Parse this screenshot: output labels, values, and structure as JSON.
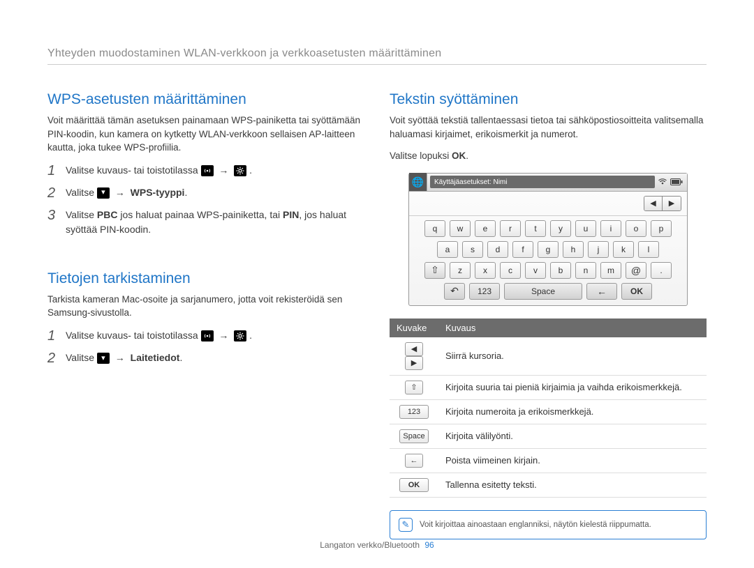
{
  "header": {
    "title": "Yhteyden muodostaminen WLAN-verkkoon ja verkkoasetusten määrittäminen"
  },
  "left": {
    "sec1": {
      "title": "WPS-asetusten määrittäminen",
      "intro": "Voit määrittää tämän asetuksen painamaan WPS-painiketta tai syöttämään PIN-koodin, kun kamera on kytketty WLAN-verkkoon sellaisen AP-laitteen kautta, joka tukee WPS-profiilia.",
      "step1_pre": "Valitse kuvaus- tai toistotilassa",
      "step2_pre": "Valitse",
      "step2_bold": "WPS-tyyppi",
      "step3_a": "Valitse ",
      "step3_pbc": "PBC",
      "step3_b": " jos haluat painaa WPS-painiketta, tai ",
      "step3_pin": "PIN",
      "step3_c": ", jos haluat syöttää PIN-koodin.",
      "dot": "."
    },
    "sec2": {
      "title": "Tietojen tarkistaminen",
      "intro": "Tarkista kameran Mac-osoite ja sarjanumero, jotta voit rekisteröidä sen Samsung-sivustolla.",
      "step1_pre": "Valitse kuvaus- tai toistotilassa",
      "step2_pre": "Valitse",
      "step2_bold": "Laitetiedot",
      "dot": "."
    }
  },
  "right": {
    "title": "Tekstin syöttäminen",
    "intro": "Voit syöttää tekstiä tallentaessasi tietoa tai sähköpostiosoitteita valitsemalla haluamasi kirjaimet, erikoismerkit ja numerot.",
    "closing_pre": "Valitse lopuksi ",
    "closing_ok": "OK",
    "closing_dot": "."
  },
  "keyboard": {
    "title": "Käyttäjäasetukset: Nimi",
    "row1": [
      "q",
      "w",
      "e",
      "r",
      "t",
      "y",
      "u",
      "i",
      "o",
      "p"
    ],
    "row2": [
      "a",
      "s",
      "d",
      "f",
      "g",
      "h",
      "j",
      "k",
      "l"
    ],
    "row3_mid": [
      "z",
      "x",
      "c",
      "v",
      "b",
      "n",
      "m"
    ],
    "row3_at": "@",
    "row3_dot": ".",
    "bottom": {
      "num": "123",
      "space": "Space",
      "ok": "OK"
    }
  },
  "table": {
    "hdr_icon": "Kuvake",
    "hdr_desc": "Kuvaus",
    "rows": [
      {
        "desc": "Siirrä kursoria."
      },
      {
        "desc": "Kirjoita suuria tai pieniä kirjaimia ja vaihda erikoismerkkejä."
      },
      {
        "desc": "Kirjoita numeroita ja erikoismerkkejä."
      },
      {
        "desc": "Kirjoita välilyönti."
      },
      {
        "desc": "Poista viimeinen kirjain."
      },
      {
        "desc": "Tallenna esitetty teksti."
      }
    ],
    "icons": {
      "num": "123",
      "space": "Space",
      "ok": "OK"
    }
  },
  "note": {
    "text": "Voit kirjoittaa ainoastaan englanniksi, näytön kielestä riippumatta."
  },
  "footer": {
    "text": "Langaton verkko/Bluetooth",
    "page": "96"
  }
}
